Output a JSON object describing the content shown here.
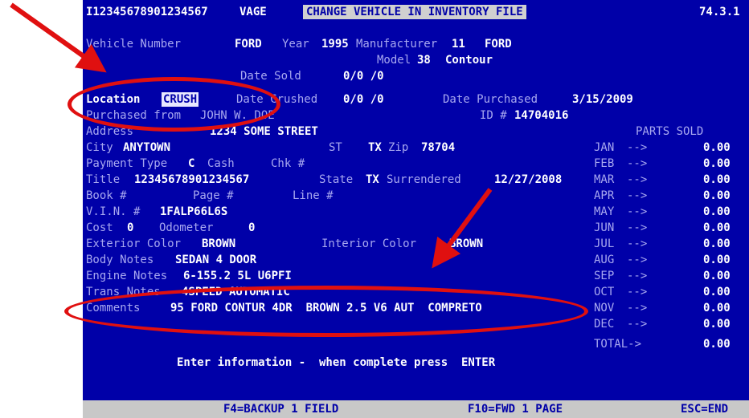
{
  "header": {
    "id": "I12345678901234567",
    "app": "VAGE",
    "title": "CHANGE VEHICLE IN INVENTORY FILE",
    "version": "74.3.1"
  },
  "vehicle": {
    "number_label": "Vehicle Number",
    "number": "FORD",
    "year_label": "Year",
    "year": "1995",
    "manufacturer_label": "Manufacturer",
    "manufacturer_code": "11",
    "manufacturer": "FORD",
    "model_label": "Model",
    "model_code": "38",
    "model": "Contour"
  },
  "dates": {
    "sold_label": "Date Sold",
    "sold": "0/0 /0",
    "crushed_label": "Date Crushed",
    "crushed": "0/0 /0",
    "purchased_label": "Date Purchased",
    "purchased": "3/15/2009"
  },
  "location": {
    "label": "Location",
    "value": "CRUSH"
  },
  "purchase": {
    "from_label": "Purchased from",
    "from": "JOHN W. DOE",
    "id_label": "ID #",
    "id": "14704016"
  },
  "address": {
    "label": "Address",
    "value": "1234 SOME STREET"
  },
  "city": {
    "label": "City",
    "value": "ANYTOWN",
    "st_label": "ST",
    "st": "TX",
    "zip_label": "Zip",
    "zip": "78704"
  },
  "payment": {
    "label": "Payment Type",
    "type": "C",
    "type_text": "Cash",
    "chk_label": "Chk #"
  },
  "title_row": {
    "label": "Title",
    "value": "12345678901234567",
    "state_label": "State",
    "state": "TX",
    "surrendered_label": "Surrendered",
    "surrendered": "12/27/2008"
  },
  "book": {
    "book_label": "Book #",
    "page_label": "Page #",
    "line_label": "Line #"
  },
  "vin": {
    "label": "V.I.N. #",
    "value": "1FALP66L6S"
  },
  "cost": {
    "label": "Cost",
    "value": "0",
    "odometer_label": "Odometer",
    "odometer": "0"
  },
  "colors": {
    "exterior_label": "Exterior Color",
    "exterior": "BROWN",
    "interior_label": "Interior Color",
    "interior": "BROWN"
  },
  "body_notes": {
    "label": "Body Notes",
    "value": "SEDAN 4 DOOR"
  },
  "engine_notes": {
    "label": "Engine Notes",
    "value": "6-155.2 5L U6PFI"
  },
  "trans_notes": {
    "label": "Trans Notes",
    "value": "4SPEED AUTOMATIC"
  },
  "comments": {
    "label": "Comments",
    "value": "95 FORD CONTUR 4DR  BROWN 2.5 V6 AUT  COMPRETO"
  },
  "parts_sold": {
    "title": "PARTS SOLD",
    "months": [
      {
        "m": "JAN",
        "v": "0.00"
      },
      {
        "m": "FEB",
        "v": "0.00"
      },
      {
        "m": "MAR",
        "v": "0.00"
      },
      {
        "m": "APR",
        "v": "0.00"
      },
      {
        "m": "MAY",
        "v": "0.00"
      },
      {
        "m": "JUN",
        "v": "0.00"
      },
      {
        "m": "JUL",
        "v": "0.00"
      },
      {
        "m": "AUG",
        "v": "0.00"
      },
      {
        "m": "SEP",
        "v": "0.00"
      },
      {
        "m": "OCT",
        "v": "0.00"
      },
      {
        "m": "NOV",
        "v": "0.00"
      },
      {
        "m": "DEC",
        "v": "0.00"
      }
    ],
    "arrow": "-->",
    "total_label": "TOTAL->",
    "total": "0.00"
  },
  "prompt": "Enter information -  when complete press  ENTER",
  "footer": {
    "f4": "F4=BACKUP 1 FIELD",
    "f10": "F10=FWD 1 PAGE",
    "esc": "ESC=END"
  },
  "colors_theme": {
    "screen_bg": "#0000a8",
    "annotation": "#e01010"
  }
}
